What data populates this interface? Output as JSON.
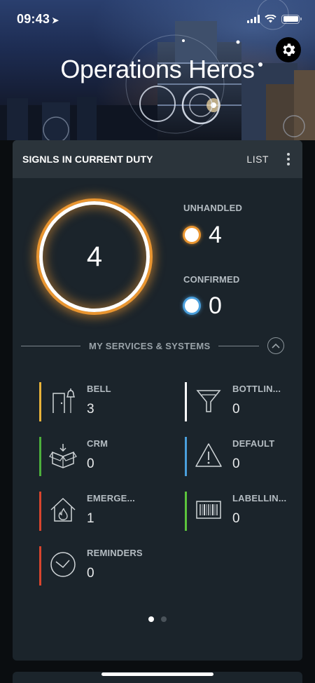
{
  "status_bar": {
    "time": "09:43",
    "location_arrow": "➤"
  },
  "header": {
    "title": "Operations Heros",
    "settings_icon": "gear-icon"
  },
  "card": {
    "title": "SIGNLS IN CURRENT DUTY",
    "list_label": "LIST",
    "total": "4",
    "unhandled": {
      "label": "UNHANDLED",
      "value": "4",
      "color": "#e99530"
    },
    "confirmed": {
      "label": "CONFIRMED",
      "value": "0",
      "color": "#4a9fdc"
    },
    "section_title": "MY SERVICES & SYSTEMS",
    "services": [
      {
        "name": "BELL",
        "count": "3",
        "color": "#e8b33a",
        "icon": "door-bell-icon"
      },
      {
        "name": "BOTTLIN...",
        "count": "0",
        "color": "#ffffff",
        "icon": "funnel-icon"
      },
      {
        "name": "CRM",
        "count": "0",
        "color": "#4caf3c",
        "icon": "open-box-icon"
      },
      {
        "name": "DEFAULT",
        "count": "0",
        "color": "#4a9fdc",
        "icon": "warning-triangle-icon"
      },
      {
        "name": "EMERGE...",
        "count": "1",
        "color": "#d8452e",
        "icon": "house-fire-icon"
      },
      {
        "name": "LABELLIN...",
        "count": "0",
        "color": "#5cc43c",
        "icon": "barcode-icon"
      },
      {
        "name": "REMINDERS",
        "count": "0",
        "color": "#d8452e",
        "icon": "clock-icon"
      }
    ],
    "pager": {
      "pages": 2,
      "active": 1
    }
  }
}
